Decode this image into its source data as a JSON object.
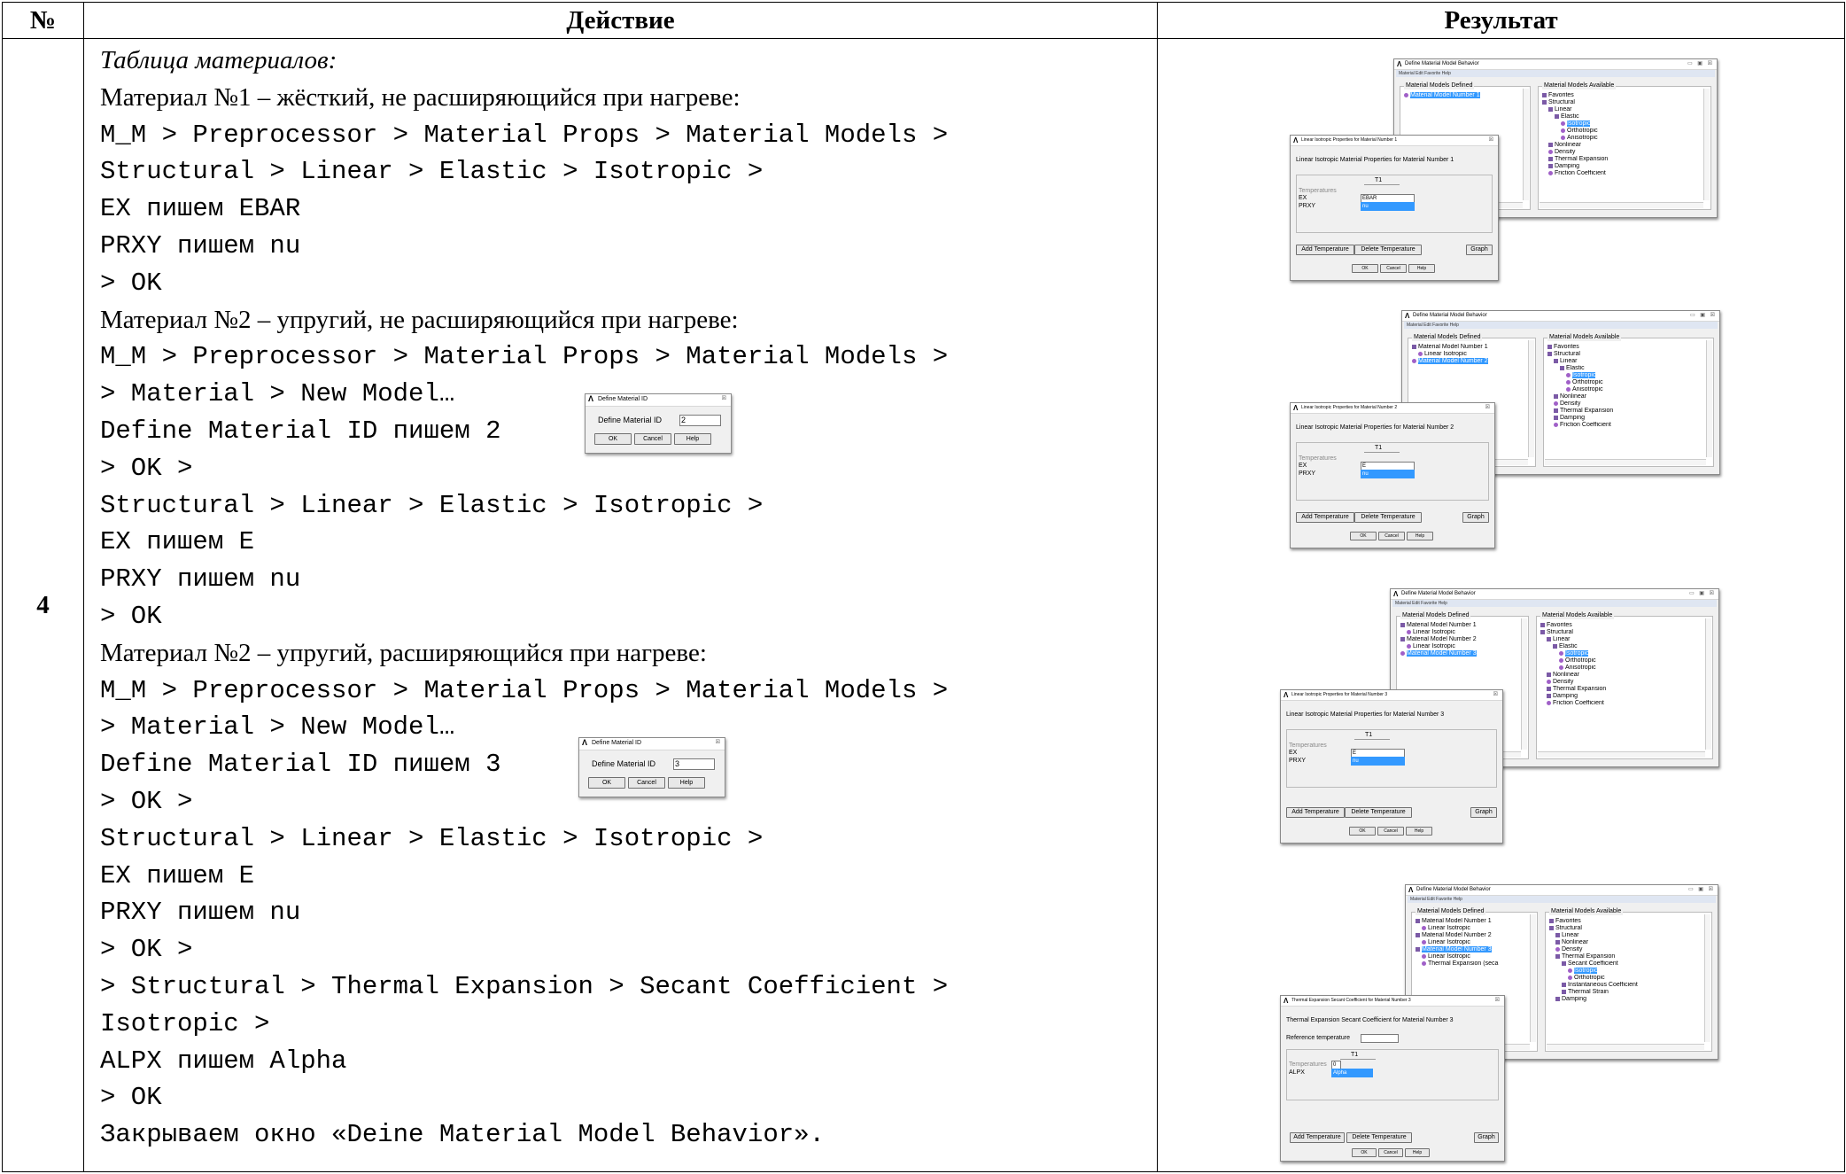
{
  "table": {
    "headers": {
      "num": "№",
      "action": "Действие",
      "result": "Результат"
    },
    "row_number": "4"
  },
  "action": {
    "lines": [
      {
        "text": "Таблица материалов:",
        "style": "serif ital"
      },
      {
        "text": "Материал №1 – жёсткий, не расширяющийся при нагреве:",
        "style": "serif"
      },
      {
        "text": "M_M > Preprocessor > Material Props > Material Models >",
        "style": "mono"
      },
      {
        "text": "Structural > Linear > Elastic > Isotropic >",
        "style": "mono"
      },
      {
        "text": "EX пишем EBAR",
        "style": "mono"
      },
      {
        "text": "PRXY пишем nu",
        "style": "mono"
      },
      {
        "text": "> OK",
        "style": "mono"
      },
      {
        "text": "Материал №2 – упругий, не расширяющийся при нагреве:",
        "style": "serif"
      },
      {
        "text": "M_M > Preprocessor > Material Props > Material Models >",
        "style": "mono"
      },
      {
        "text": "> Material > New Model…",
        "style": "mono"
      },
      {
        "text": "Define Material ID пишем 2",
        "style": "mono"
      },
      {
        "text": "> OK >",
        "style": "mono"
      },
      {
        "text": "Structural > Linear > Elastic > Isotropic >",
        "style": "mono"
      },
      {
        "text": "EX пишем E",
        "style": "mono"
      },
      {
        "text": "PRXY пишем nu",
        "style": "mono"
      },
      {
        "text": "> OK",
        "style": "mono"
      },
      {
        "text": "Материал №2 – упругий, расширяющийся при нагреве:",
        "style": "serif"
      },
      {
        "text": "M_M > Preprocessor > Material Props > Material Models >",
        "style": "mono"
      },
      {
        "text": "> Material > New Model…",
        "style": "mono"
      },
      {
        "text": "Define Material ID пишем 3",
        "style": "mono"
      },
      {
        "text": "> OK >",
        "style": "mono"
      },
      {
        "text": "Structural > Linear > Elastic > Isotropic >",
        "style": "mono"
      },
      {
        "text": "EX пишем E",
        "style": "mono"
      },
      {
        "text": "PRXY пишем nu",
        "style": "mono"
      },
      {
        "text": "> OK >",
        "style": "mono"
      },
      {
        "text": "> Structural > Thermal Expansion > Secant Coefficient >",
        "style": "mono"
      },
      {
        "text": "Isotropic >",
        "style": "mono"
      },
      {
        "text": "ALPX пишем Alpha",
        "style": "mono"
      },
      {
        "text": "> OK",
        "style": "mono"
      },
      {
        "text": "Закрываем окно «Deine Material Model Behavior».",
        "style": "mono"
      }
    ],
    "define_id_dialogs": [
      {
        "title": "Define Material ID",
        "label": "Define Material ID",
        "value": "2",
        "ok": "OK",
        "cancel": "Cancel",
        "help": "Help"
      },
      {
        "title": "Define Material ID",
        "label": "Define Material ID",
        "value": "3",
        "ok": "OK",
        "cancel": "Cancel",
        "help": "Help"
      }
    ]
  },
  "result": {
    "main_title": "Define Material Model Behavior",
    "menu": "Material   Edit   Favorite   Help",
    "defined_label": "Material Models Defined",
    "available_label": "Material Models Available",
    "window_controls": "▭ ▣ ☒",
    "shots": [
      {
        "defined": [
          {
            "text": "Material Model Number 1",
            "icon": "leaf",
            "indent": 0,
            "sel": true
          }
        ],
        "available": [
          {
            "text": "Favorites",
            "icon": "fold",
            "indent": 0
          },
          {
            "text": "Structural",
            "icon": "fold",
            "indent": 0
          },
          {
            "text": "Linear",
            "icon": "fold",
            "indent": 1
          },
          {
            "text": "Elastic",
            "icon": "fold",
            "indent": 2
          },
          {
            "text": "Isotropic",
            "icon": "leaf",
            "indent": 3,
            "sel": true
          },
          {
            "text": "Orthotropic",
            "icon": "leaf",
            "indent": 3
          },
          {
            "text": "Anisotropic",
            "icon": "leaf",
            "indent": 3
          },
          {
            "text": "Nonlinear",
            "icon": "fold",
            "indent": 1
          },
          {
            "text": "Density",
            "icon": "leaf",
            "indent": 1
          },
          {
            "text": "Thermal Expansion",
            "icon": "fold",
            "indent": 1
          },
          {
            "text": "Damping",
            "icon": "fold",
            "indent": 1
          },
          {
            "text": "Friction Coefficient",
            "icon": "leaf",
            "indent": 1
          }
        ],
        "prop": {
          "title": "Linear Isotropic Properties for Material Number 1",
          "heading": "Linear Isotropic Material Properties for Material Number 1",
          "col": "T1",
          "temps": "Temperatures",
          "rows": [
            {
              "label": "EX",
              "value": "EBAR",
              "sel": false
            },
            {
              "label": "PRXY",
              "value": "nu",
              "sel": true
            }
          ],
          "add": "Add Temperature",
          "del": "Delete Temperature",
          "graph": "Graph",
          "ok": "OK",
          "cancel": "Cancel",
          "help": "Help"
        }
      },
      {
        "defined": [
          {
            "text": "Material Model Number 1",
            "icon": "fold",
            "indent": 0
          },
          {
            "text": "Linear Isotropic",
            "icon": "leaf",
            "indent": 1
          },
          {
            "text": "Material Model Number 2",
            "icon": "leaf",
            "indent": 0,
            "sel": true
          }
        ],
        "available": [
          {
            "text": "Favorites",
            "icon": "fold",
            "indent": 0
          },
          {
            "text": "Structural",
            "icon": "fold",
            "indent": 0
          },
          {
            "text": "Linear",
            "icon": "fold",
            "indent": 1
          },
          {
            "text": "Elastic",
            "icon": "fold",
            "indent": 2
          },
          {
            "text": "Isotropic",
            "icon": "leaf",
            "indent": 3,
            "sel": true
          },
          {
            "text": "Orthotropic",
            "icon": "leaf",
            "indent": 3
          },
          {
            "text": "Anisotropic",
            "icon": "leaf",
            "indent": 3
          },
          {
            "text": "Nonlinear",
            "icon": "fold",
            "indent": 1
          },
          {
            "text": "Density",
            "icon": "leaf",
            "indent": 1
          },
          {
            "text": "Thermal Expansion",
            "icon": "fold",
            "indent": 1
          },
          {
            "text": "Damping",
            "icon": "fold",
            "indent": 1
          },
          {
            "text": "Friction Coefficient",
            "icon": "leaf",
            "indent": 1
          }
        ],
        "prop": {
          "title": "Linear Isotropic Properties for Material Number 2",
          "heading": "Linear Isotropic Material Properties for Material Number 2",
          "col": "T1",
          "temps": "Temperatures",
          "rows": [
            {
              "label": "EX",
              "value": "E",
              "sel": false
            },
            {
              "label": "PRXY",
              "value": "nu",
              "sel": true
            }
          ],
          "add": "Add Temperature",
          "del": "Delete Temperature",
          "graph": "Graph",
          "ok": "OK",
          "cancel": "Cancel",
          "help": "Help"
        }
      },
      {
        "defined": [
          {
            "text": "Material Model Number 1",
            "icon": "fold",
            "indent": 0
          },
          {
            "text": "Linear Isotropic",
            "icon": "leaf",
            "indent": 1
          },
          {
            "text": "Material Model Number 2",
            "icon": "fold",
            "indent": 0
          },
          {
            "text": "Linear Isotropic",
            "icon": "leaf",
            "indent": 1
          },
          {
            "text": "Material Model Number 3",
            "icon": "leaf",
            "indent": 0,
            "sel": true
          }
        ],
        "available": [
          {
            "text": "Favorites",
            "icon": "fold",
            "indent": 0
          },
          {
            "text": "Structural",
            "icon": "fold",
            "indent": 0
          },
          {
            "text": "Linear",
            "icon": "fold",
            "indent": 1
          },
          {
            "text": "Elastic",
            "icon": "fold",
            "indent": 2
          },
          {
            "text": "Isotropic",
            "icon": "leaf",
            "indent": 3,
            "sel": true
          },
          {
            "text": "Orthotropic",
            "icon": "leaf",
            "indent": 3
          },
          {
            "text": "Anisotropic",
            "icon": "leaf",
            "indent": 3
          },
          {
            "text": "Nonlinear",
            "icon": "fold",
            "indent": 1
          },
          {
            "text": "Density",
            "icon": "leaf",
            "indent": 1
          },
          {
            "text": "Thermal Expansion",
            "icon": "fold",
            "indent": 1
          },
          {
            "text": "Damping",
            "icon": "fold",
            "indent": 1
          },
          {
            "text": "Friction Coefficient",
            "icon": "leaf",
            "indent": 1
          }
        ],
        "prop": {
          "title": "Linear Isotropic Properties for Material Number 3",
          "heading": "Linear Isotropic Material Properties for Material Number 3",
          "col": "T1",
          "temps": "Temperatures",
          "rows": [
            {
              "label": "EX",
              "value": "E",
              "sel": false
            },
            {
              "label": "PRXY",
              "value": "nu",
              "sel": true
            }
          ],
          "add": "Add Temperature",
          "del": "Delete Temperature",
          "graph": "Graph",
          "ok": "OK",
          "cancel": "Cancel",
          "help": "Help"
        }
      },
      {
        "defined": [
          {
            "text": "Material Model Number 1",
            "icon": "fold",
            "indent": 0
          },
          {
            "text": "Linear Isotropic",
            "icon": "leaf",
            "indent": 1
          },
          {
            "text": "Material Model Number 2",
            "icon": "fold",
            "indent": 0
          },
          {
            "text": "Linear Isotropic",
            "icon": "leaf",
            "indent": 1
          },
          {
            "text": "Material Model Number 3",
            "icon": "fold",
            "indent": 0,
            "sel": true
          },
          {
            "text": "Linear Isotropic",
            "icon": "leaf",
            "indent": 1
          },
          {
            "text": "Thermal Expansion (seca",
            "icon": "leaf",
            "indent": 1
          }
        ],
        "available": [
          {
            "text": "Favorites",
            "icon": "fold",
            "indent": 0
          },
          {
            "text": "Structural",
            "icon": "fold",
            "indent": 0
          },
          {
            "text": "Linear",
            "icon": "fold",
            "indent": 1
          },
          {
            "text": "Nonlinear",
            "icon": "fold",
            "indent": 1
          },
          {
            "text": "Density",
            "icon": "leaf",
            "indent": 1
          },
          {
            "text": "Thermal Expansion",
            "icon": "fold",
            "indent": 1
          },
          {
            "text": "Secant Coefficient",
            "icon": "fold",
            "indent": 2
          },
          {
            "text": "Isotropic",
            "icon": "leaf",
            "indent": 3,
            "sel": true
          },
          {
            "text": "Orthotropic",
            "icon": "leaf",
            "indent": 3
          },
          {
            "text": "Instantaneous Coefficient",
            "icon": "fold",
            "indent": 2
          },
          {
            "text": "Thermal Strain",
            "icon": "fold",
            "indent": 2
          },
          {
            "text": "Damping",
            "icon": "fold",
            "indent": 1
          }
        ],
        "thermal": {
          "title": "Thermal Expansion Secant Coefficient for Material Number 3",
          "heading": "Thermal Expansion Secant Coefficient for Material Number 3",
          "ref_label": "Reference temperature",
          "col": "T1",
          "temps": "Temperatures",
          "temp_value": "0",
          "row_label": "ALPX",
          "row_value": "Alpha",
          "add": "Add Temperature",
          "del": "Delete Temperature",
          "graph": "Graph",
          "ok": "OK",
          "cancel": "Cancel",
          "help": "Help"
        }
      }
    ]
  }
}
